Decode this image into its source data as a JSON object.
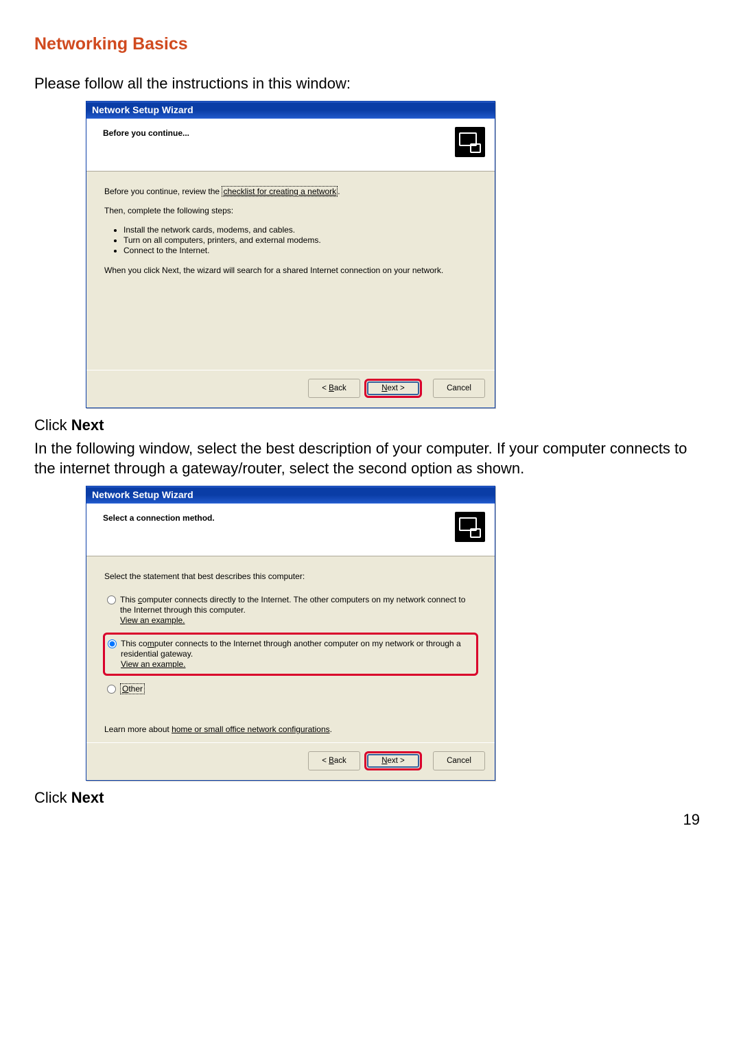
{
  "heading": "Networking Basics",
  "intro": "Please follow all the instructions in this window:",
  "click_prefix": "Click ",
  "click_word": "Next",
  "para2": "In the following window, select the best description of your computer.  If your computer connects to the internet through a gateway/router, select the second option as shown.",
  "page_number": "19",
  "wizard1": {
    "title": "Network Setup Wizard",
    "header": "Before you continue...",
    "body_intro_before": "Before you continue, review the ",
    "body_intro_link": "checklist for creating a network",
    "body_intro_after": ".",
    "then_line": "Then, complete the following steps:",
    "steps": [
      "Install the network cards, modems, and cables.",
      "Turn on all computers, printers, and external modems.",
      "Connect to the Internet."
    ],
    "note": "When you click Next, the wizard will search for a shared Internet connection on your network.",
    "buttons": {
      "back": "< Back",
      "next": "Next >",
      "cancel": "Cancel"
    },
    "underline": {
      "back": "B",
      "next": "N"
    }
  },
  "wizard2": {
    "title": "Network Setup Wizard",
    "header": "Select a connection method.",
    "select_line": "Select the statement that best describes this computer:",
    "option1": {
      "text_before": "This ",
      "underline": "c",
      "text_after": "omputer connects directly to the Internet. The other computers on my network connect to the Internet through this computer.",
      "example": "View an example."
    },
    "option2": {
      "text_before": "This co",
      "underline": "m",
      "text_after": "puter connects to the Internet through another computer on my network or through a residential gateway.",
      "example": "View an example."
    },
    "option3": {
      "underline": "O",
      "text": "ther"
    },
    "learn_before": "Learn more about ",
    "learn_link": "home or small office network configurations",
    "learn_after": ".",
    "buttons": {
      "back": "< Back",
      "next": "Next >",
      "cancel": "Cancel"
    },
    "underline": {
      "back": "B",
      "next": "N"
    }
  }
}
